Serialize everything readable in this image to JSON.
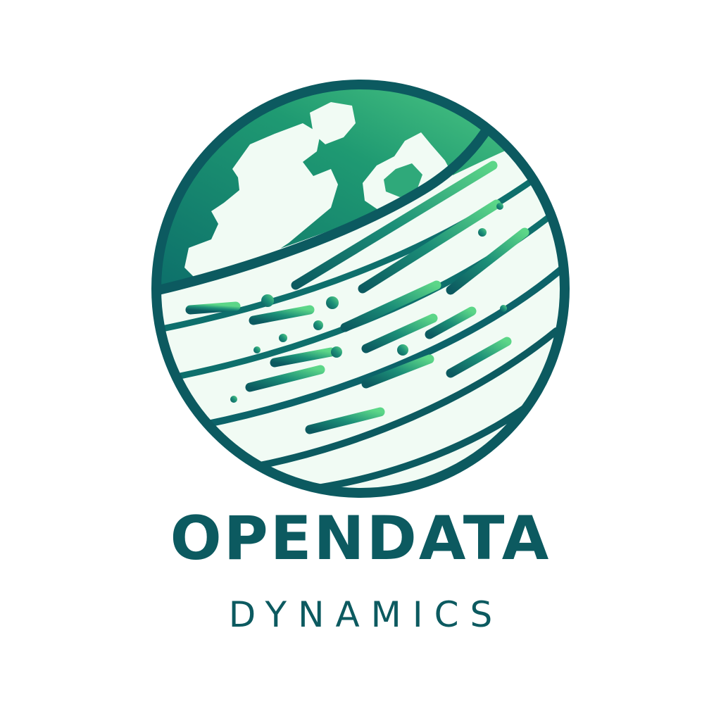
{
  "logo": {
    "brand_name": "OPENDATA",
    "brand_sub": "DYNAMICS",
    "icon": "globe-icon",
    "colors": {
      "teal_dark": "#0c5a60",
      "teal": "#0e7c74",
      "green": "#2fa97a",
      "light_green": "#5cd688",
      "globe_fill": "#f1fbf4",
      "background": "#ffffff"
    }
  }
}
